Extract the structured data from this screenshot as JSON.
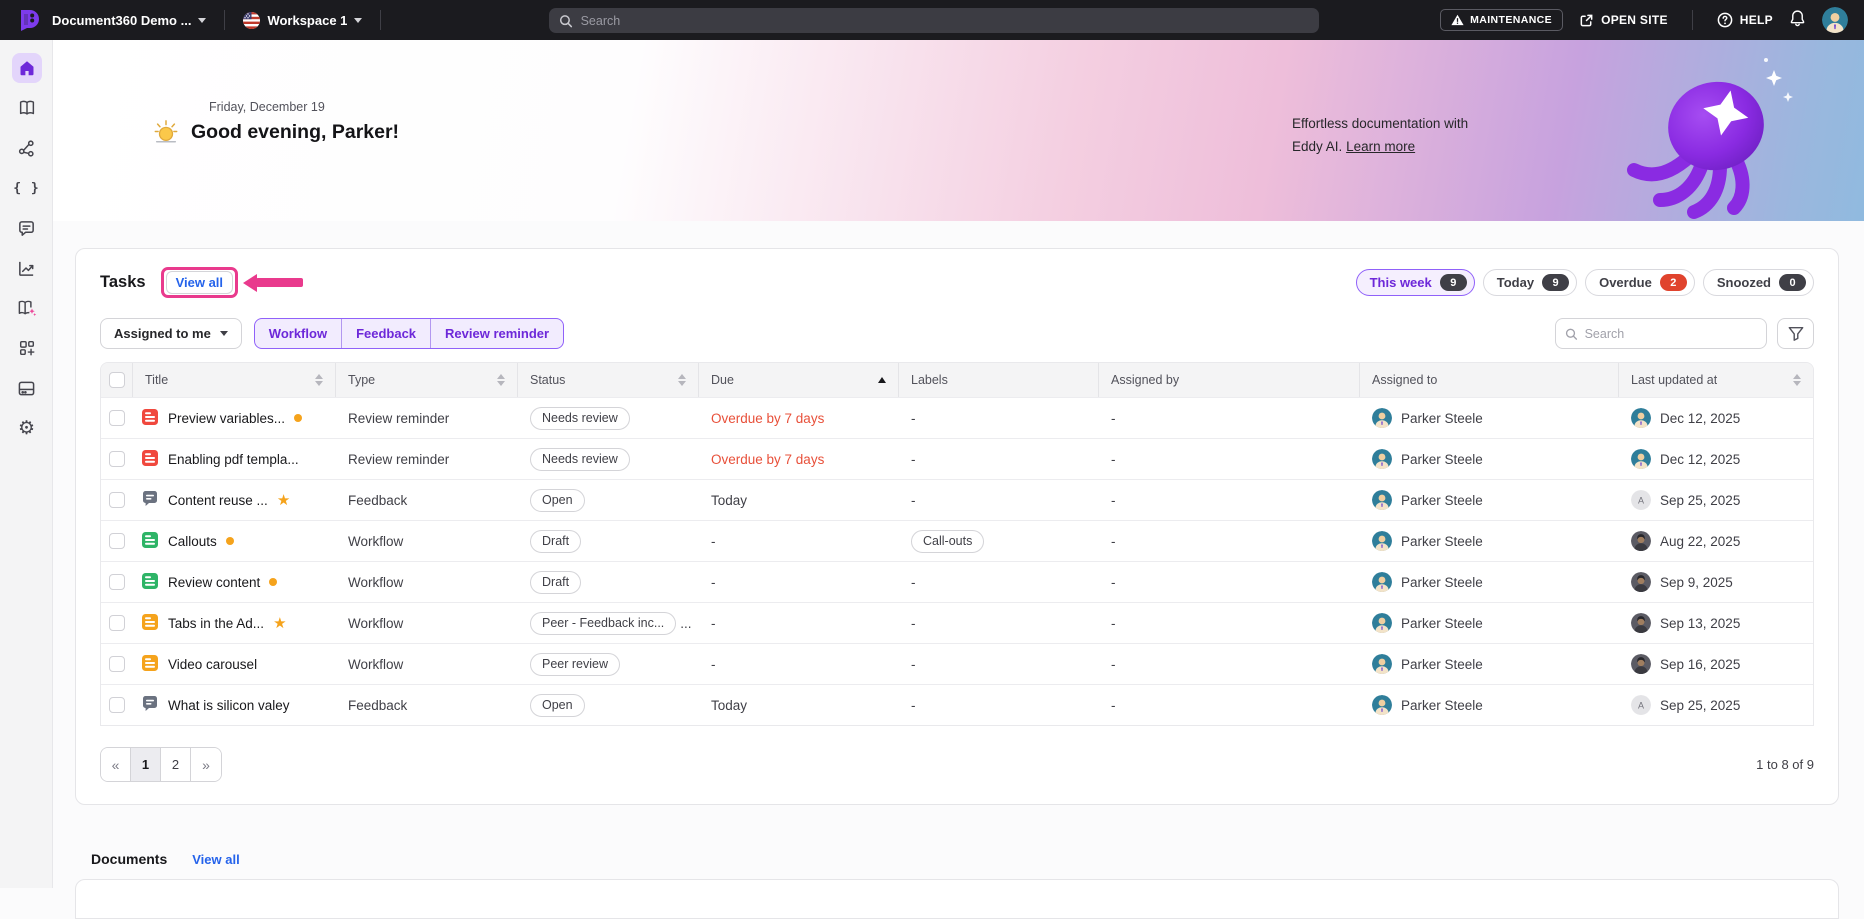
{
  "topbar": {
    "project_name": "Document360 Demo ...",
    "workspace_name": "Workspace 1",
    "search_placeholder": "Search",
    "maintenance_label": "MAINTENANCE",
    "open_site_label": "OPEN SITE",
    "help_label": "HELP"
  },
  "sidebar": {
    "items": [
      {
        "name": "home",
        "active": true
      },
      {
        "name": "documentation-book",
        "active": false
      },
      {
        "name": "categories-sitemap",
        "active": false
      },
      {
        "name": "api-braces",
        "active": false
      },
      {
        "name": "feedback-comment",
        "active": false
      },
      {
        "name": "analytics-chart",
        "active": false
      },
      {
        "name": "eddy-ai-book",
        "active": false
      },
      {
        "name": "apps-grid-plus",
        "active": false
      },
      {
        "name": "drive",
        "active": false
      },
      {
        "name": "settings-gear",
        "active": false
      }
    ]
  },
  "hero": {
    "date": "Friday, December 19",
    "greeting": "Good evening, Parker!",
    "promo_line1": "Effortless documentation with",
    "promo_line2": "Eddy AI.",
    "promo_link": "Learn more"
  },
  "tasks": {
    "title": "Tasks",
    "view_all_label": "View all",
    "chips": [
      {
        "label": "This week",
        "count": "9",
        "badge": "dark",
        "active": true
      },
      {
        "label": "Today",
        "count": "9",
        "badge": "dark",
        "active": false
      },
      {
        "label": "Overdue",
        "count": "2",
        "badge": "red",
        "active": false
      },
      {
        "label": "Snoozed",
        "count": "0",
        "badge": "dark",
        "active": false
      }
    ],
    "assignee_filter_label": "Assigned to me",
    "type_tabs": [
      "Workflow",
      "Feedback",
      "Review reminder"
    ],
    "search_placeholder": "Search",
    "columns": [
      {
        "label": "Title",
        "sort": "both"
      },
      {
        "label": "Type",
        "sort": "both"
      },
      {
        "label": "Status",
        "sort": "both"
      },
      {
        "label": "Due",
        "sort": "asc"
      },
      {
        "label": "Labels",
        "sort": "none"
      },
      {
        "label": "Assigned by",
        "sort": "none"
      },
      {
        "label": "Assigned to",
        "sort": "none"
      },
      {
        "label": "Last updated at",
        "sort": "both"
      }
    ],
    "rows": [
      {
        "title": "Preview variables...",
        "icon": "doc-red",
        "marker": "dot",
        "type": "Review reminder",
        "status": "Needs review",
        "status_extra": "",
        "due": "Overdue by 7 days",
        "due_overdue": true,
        "label_pill": "",
        "labels": "-",
        "assigned_by": "-",
        "assigned_to": "Parker Steele",
        "assigned_to_avatar": "person-teal",
        "updated": "Dec 12, 2025",
        "updated_avatar": "person-teal"
      },
      {
        "title": "Enabling pdf templa...",
        "icon": "doc-red",
        "marker": "",
        "type": "Review reminder",
        "status": "Needs review",
        "status_extra": "",
        "due": "Overdue by 7 days",
        "due_overdue": true,
        "label_pill": "",
        "labels": "-",
        "assigned_by": "-",
        "assigned_to": "Parker Steele",
        "assigned_to_avatar": "person-teal",
        "updated": "Dec 12, 2025",
        "updated_avatar": "person-teal"
      },
      {
        "title": "Content reuse ...",
        "icon": "comment",
        "marker": "star",
        "type": "Feedback",
        "status": "Open",
        "status_extra": "",
        "due": "Today",
        "due_overdue": false,
        "label_pill": "",
        "labels": "-",
        "assigned_by": "-",
        "assigned_to": "Parker Steele",
        "assigned_to_avatar": "person-teal",
        "updated": "Sep 25, 2025",
        "updated_avatar": "letter-a"
      },
      {
        "title": "Callouts",
        "icon": "doc-green",
        "marker": "dot",
        "type": "Workflow",
        "status": "Draft",
        "status_extra": "",
        "due": "-",
        "due_overdue": false,
        "label_pill": "Call-outs",
        "labels": "",
        "assigned_by": "-",
        "assigned_to": "Parker Steele",
        "assigned_to_avatar": "person-teal",
        "updated": "Aug 22, 2025",
        "updated_avatar": "person-dark"
      },
      {
        "title": "Review content",
        "icon": "doc-green",
        "marker": "dot",
        "type": "Workflow",
        "status": "Draft",
        "status_extra": "",
        "due": "-",
        "due_overdue": false,
        "label_pill": "",
        "labels": "-",
        "assigned_by": "-",
        "assigned_to": "Parker Steele",
        "assigned_to_avatar": "person-teal",
        "updated": "Sep 9, 2025",
        "updated_avatar": "person-dark"
      },
      {
        "title": "Tabs in the Ad...",
        "icon": "doc-orange",
        "marker": "star",
        "type": "Workflow",
        "status": "Peer - Feedback inc...",
        "status_extra": "...",
        "due": "-",
        "due_overdue": false,
        "label_pill": "",
        "labels": "-",
        "assigned_by": "-",
        "assigned_to": "Parker Steele",
        "assigned_to_avatar": "person-teal",
        "updated": "Sep 13, 2025",
        "updated_avatar": "person-dark"
      },
      {
        "title": "Video carousel",
        "icon": "doc-orange",
        "marker": "",
        "type": "Workflow",
        "status": "Peer review",
        "status_extra": "",
        "due": "-",
        "due_overdue": false,
        "label_pill": "",
        "labels": "-",
        "assigned_by": "-",
        "assigned_to": "Parker Steele",
        "assigned_to_avatar": "person-teal",
        "updated": "Sep 16, 2025",
        "updated_avatar": "person-dark"
      },
      {
        "title": "What is silicon valey",
        "icon": "comment",
        "marker": "",
        "type": "Feedback",
        "status": "Open",
        "status_extra": "",
        "due": "Today",
        "due_overdue": false,
        "label_pill": "",
        "labels": "-",
        "assigned_by": "-",
        "assigned_to": "Parker Steele",
        "assigned_to_avatar": "person-teal",
        "updated": "Sep 25, 2025",
        "updated_avatar": "letter-a"
      }
    ],
    "pagination": {
      "nav_prev": "«",
      "pages": [
        "1",
        "2"
      ],
      "current": "1",
      "nav_next": "»",
      "summary": "1 to 8 of 9"
    }
  },
  "documents": {
    "title": "Documents",
    "view_all_label": "View all"
  },
  "colors": {
    "annotation_pink": "#e93a8d",
    "link_blue": "#2563eb",
    "overdue_text": "#e8503a",
    "badge_dark": "#3f3f46",
    "badge_red": "#e0432d",
    "active_chip_bg": "#f5effe",
    "active_chip_border": "#9061f9",
    "accent_purple": "#6d28d9"
  }
}
